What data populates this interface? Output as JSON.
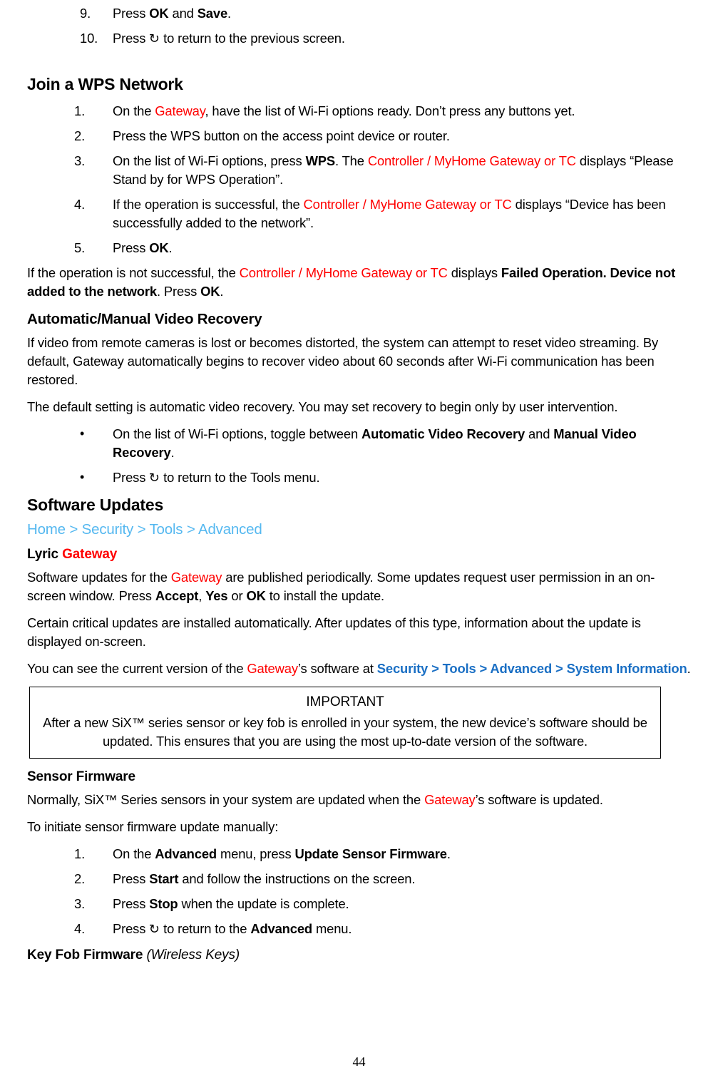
{
  "document": {
    "page_number": "44",
    "colors": {
      "red_term": "#FF0000",
      "breadcrumb_blue": "#55B8F0",
      "inline_link_blue": "#1A6FC4",
      "text": "#000000"
    }
  },
  "continued_list": {
    "items": [
      {
        "num": "9.",
        "parts": [
          {
            "t": "Press ",
            "s": "normal"
          },
          {
            "t": "OK",
            "s": "bold"
          },
          {
            "t": " and ",
            "s": "normal"
          },
          {
            "t": "Save",
            "s": "bold"
          },
          {
            "t": ".",
            "s": "normal"
          }
        ]
      },
      {
        "num": "10.",
        "parts": [
          {
            "t": "Press ",
            "s": "normal"
          },
          {
            "t": "↺",
            "s": "icon"
          },
          {
            "t": "  to return to the previous screen.",
            "s": "normal"
          }
        ]
      }
    ]
  },
  "wps_section": {
    "heading": "Join a WPS Network",
    "steps": [
      {
        "num": "1.",
        "parts": [
          {
            "t": "On the ",
            "s": "normal"
          },
          {
            "t": "Gateway",
            "s": "red"
          },
          {
            "t": ", have the list of Wi-Fi options ready. Don’t press any buttons yet.",
            "s": "normal"
          }
        ]
      },
      {
        "num": "2.",
        "parts": [
          {
            "t": "Press the WPS button on the access point device or router.",
            "s": "normal"
          }
        ]
      },
      {
        "num": "3.",
        "parts": [
          {
            "t": "On the list of Wi-Fi options, press ",
            "s": "normal"
          },
          {
            "t": "WPS",
            "s": "bold"
          },
          {
            "t": ". The ",
            "s": "normal"
          },
          {
            "t": "Controller / MyHome Gateway or TC",
            "s": "red"
          },
          {
            "t": " displays “Please Stand by for WPS Operation”.",
            "s": "normal"
          }
        ]
      },
      {
        "num": "4.",
        "parts": [
          {
            "t": "If the operation is successful, the ",
            "s": "normal"
          },
          {
            "t": "Controller / MyHome Gateway or TC",
            "s": "red"
          },
          {
            "t": " displays “Device has been successfully added to the network”.",
            "s": "normal"
          }
        ]
      },
      {
        "num": "5.",
        "parts": [
          {
            "t": "Press ",
            "s": "normal"
          },
          {
            "t": "OK",
            "s": "bold"
          },
          {
            "t": ".",
            "s": "normal"
          }
        ]
      }
    ],
    "failure_paragraph": [
      {
        "t": "If the operation is not successful, the ",
        "s": "normal"
      },
      {
        "t": "Controller / MyHome Gateway or TC",
        "s": "red"
      },
      {
        "t": " displays ",
        "s": "normal"
      },
      {
        "t": "Failed Operation. Device not added to the network",
        "s": "bold"
      },
      {
        "t": ". Press ",
        "s": "normal"
      },
      {
        "t": "OK",
        "s": "bold"
      },
      {
        "t": ".",
        "s": "normal"
      }
    ]
  },
  "video_recovery_section": {
    "heading": "Automatic/Manual Video Recovery",
    "paragraph_1": [
      {
        "t": "If video from remote cameras is lost or becomes distorted, the system can attempt to reset video streaming.  By default, Gateway automatically begins to recover video about 60 seconds after Wi-Fi communication has been restored.",
        "s": "normal"
      }
    ],
    "paragraph_2": [
      {
        "t": "The default setting is automatic video recovery. You may set recovery to begin only by user intervention.",
        "s": "normal"
      }
    ],
    "bullets": [
      {
        "parts": [
          {
            "t": "On the list of Wi-Fi options, toggle between ",
            "s": "normal"
          },
          {
            "t": "Automatic Video Recovery",
            "s": "bold"
          },
          {
            "t": " and ",
            "s": "normal"
          },
          {
            "t": "Manual Video Recovery",
            "s": "bold"
          },
          {
            "t": ".",
            "s": "normal"
          }
        ]
      },
      {
        "parts": [
          {
            "t": "Press ",
            "s": "normal"
          },
          {
            "t": "↺",
            "s": "icon"
          },
          {
            "t": "  to return to the Tools menu.",
            "s": "normal"
          }
        ]
      }
    ]
  },
  "software_updates_section": {
    "heading": "Software Updates",
    "breadcrumb": "Home > Security > Tools > Advanced",
    "lyric_heading": [
      {
        "t": "Lyric ",
        "s": "bold"
      },
      {
        "t": "Gateway",
        "s": "red-bold"
      }
    ],
    "paragraph_1": [
      {
        "t": "Software updates for the ",
        "s": "normal"
      },
      {
        "t": "Gateway",
        "s": "red"
      },
      {
        "t": " are published periodically. Some updates request user permission in an on-screen window. Press ",
        "s": "normal"
      },
      {
        "t": "Accept",
        "s": "bold"
      },
      {
        "t": ", ",
        "s": "normal"
      },
      {
        "t": "Yes",
        "s": "bold"
      },
      {
        "t": " or ",
        "s": "normal"
      },
      {
        "t": "OK",
        "s": "bold"
      },
      {
        "t": " to install the update.",
        "s": "normal"
      }
    ],
    "paragraph_2": [
      {
        "t": "Certain critical updates are installed automatically. After updates of this type, information about the update is displayed on-screen.",
        "s": "normal"
      }
    ],
    "paragraph_3": [
      {
        "t": "You can see the current version of the ",
        "s": "normal"
      },
      {
        "t": "Gateway",
        "s": "red"
      },
      {
        "t": "’s software at ",
        "s": "normal"
      },
      {
        "t": "Security > Tools > Advanced > System Information",
        "s": "blue-link"
      },
      {
        "t": ".",
        "s": "normal"
      }
    ],
    "important_box": {
      "title": "IMPORTANT",
      "body": "After a new SiX™ series sensor or key fob is enrolled in your system, the new device’s  software should be updated. This ensures that you are using the most up-to-date version of the software."
    }
  },
  "sensor_firmware_section": {
    "heading": "Sensor Firmware",
    "paragraph_1": [
      {
        "t": "Normally, SiX™ Series sensors in your system are updated when the ",
        "s": "normal"
      },
      {
        "t": "Gateway",
        "s": "red"
      },
      {
        "t": "’s software is updated.",
        "s": "normal"
      }
    ],
    "paragraph_2": [
      {
        "t": "To initiate sensor firmware update manually:",
        "s": "normal"
      }
    ],
    "steps": [
      {
        "num": "1.",
        "parts": [
          {
            "t": "On the ",
            "s": "normal"
          },
          {
            "t": "Advanced",
            "s": "bold"
          },
          {
            "t": " menu, press ",
            "s": "normal"
          },
          {
            "t": "Update Sensor Firmware",
            "s": "bold"
          },
          {
            "t": ".",
            "s": "normal"
          }
        ]
      },
      {
        "num": "2.",
        "parts": [
          {
            "t": "Press ",
            "s": "normal"
          },
          {
            "t": "Start",
            "s": "bold"
          },
          {
            "t": " and follow the instructions on the screen.",
            "s": "normal"
          }
        ]
      },
      {
        "num": "3.",
        "parts": [
          {
            "t": "Press ",
            "s": "normal"
          },
          {
            "t": "Stop",
            "s": "bold"
          },
          {
            "t": " when the update is complete.",
            "s": "normal"
          }
        ]
      },
      {
        "num": "4.",
        "parts": [
          {
            "t": "Press ",
            "s": "normal"
          },
          {
            "t": "↺",
            "s": "icon"
          },
          {
            "t": "  to return to the ",
            "s": "normal"
          },
          {
            "t": "Advanced",
            "s": "bold"
          },
          {
            "t": " menu.",
            "s": "normal"
          }
        ]
      }
    ]
  },
  "key_fob_section": {
    "heading_main": "Key Fob Firmware ",
    "heading_italic": "(Wireless Keys)"
  }
}
